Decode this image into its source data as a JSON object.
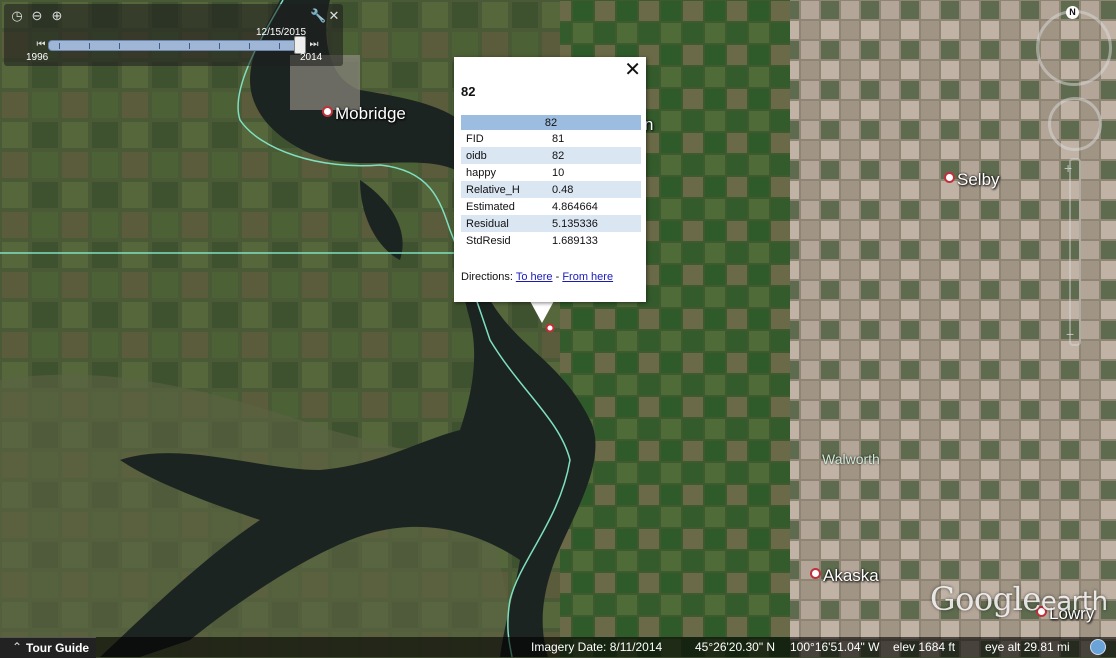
{
  "time_slider": {
    "current_date": "12/15/2015",
    "start_year": "1996",
    "end_year": "2014"
  },
  "places": {
    "mobridge": "Mobridge",
    "selby": "Selby",
    "walworth": "Walworth",
    "akaska": "Akaska",
    "lowry": "Lowry",
    "partial": "n"
  },
  "balloon": {
    "close_glyph": "✕",
    "title": "82",
    "table_header": "82",
    "rows": [
      {
        "field": "FID",
        "value": "81"
      },
      {
        "field": "oidb",
        "value": "82"
      },
      {
        "field": "happy",
        "value": "10"
      },
      {
        "field": "Relative_H",
        "value": "0.48"
      },
      {
        "field": "Estimated",
        "value": "4.864664"
      },
      {
        "field": "Residual",
        "value": "5.135336"
      },
      {
        "field": "StdResid",
        "value": "1.689133"
      }
    ],
    "directions_label": "Directions:",
    "to_here": "To here",
    "separator": "-",
    "from_here": "From here"
  },
  "nav": {
    "north": "N",
    "zoom_in": "+",
    "zoom_out": "−"
  },
  "logo": {
    "google": "Google",
    "earth": "earth"
  },
  "status": {
    "tour_guide": "Tour Guide",
    "imagery_date": "Imagery Date: 8/11/2014",
    "lat": "45°26'20.30\" N",
    "lon": "100°16'51.04\" W",
    "elev": "elev  1684 ft",
    "eye_alt": "eye alt  29.81 mi"
  },
  "colors": {
    "water": "#1c2421",
    "boundary_line": "#7fe0c0",
    "cropland_east": "#9a8c7a",
    "table_header": "#9cbce0",
    "table_alt_row": "#dbe6f3"
  }
}
